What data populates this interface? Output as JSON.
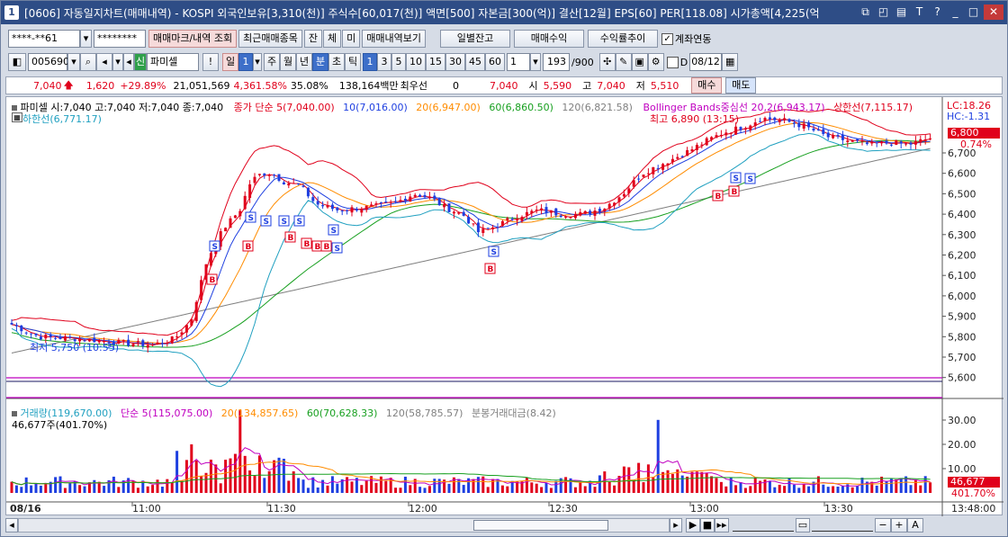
{
  "title": {
    "num": "1",
    "text": "[0606] 자동일지차트(매매내역) - KOSPI 외국인보유[3,310(천)] 주식수[60,017(천)] 액면[500] 자본금[300(억)] 결산[12월] EPS[60] PER[118.08] 시가총액[4,225(억"
  },
  "toolbar1": {
    "account": "****-**61",
    "password": "********",
    "trade_mark_btn": "매매마크/내역 조회",
    "recent_btn": "최근매매종목",
    "tab_jan": "잔",
    "tab_che": "체",
    "tab_mi": "미",
    "history_btn": "매매내역보기",
    "daily_balance_btn": "일별잔고",
    "trade_profit_btn": "매매수익",
    "profit_trend_btn": "수익률추이",
    "account_link_label": "계좌연동"
  },
  "toolbar2": {
    "code": "005690",
    "shin": "신",
    "name": "파미셀",
    "excl": "!",
    "period_day": "일",
    "period_num": "1",
    "week": "주",
    "month": "월",
    "year": "년",
    "minute": "분",
    "second": "초",
    "tick": "틱",
    "intervals": [
      "1",
      "3",
      "5",
      "10",
      "15",
      "30",
      "45",
      "60"
    ],
    "count": "1",
    "range": "193",
    "range_total": "/900",
    "d_label": "D",
    "date": "08/12"
  },
  "price": {
    "current": "7,040",
    "change": "1,620",
    "change_pct": "+29.89%",
    "volume": "21,051,569",
    "volume_ratio": "4,361.58%",
    "turnover": "35.08%",
    "amount": "138,164백만",
    "bid_label": "최우선",
    "bid_qty": "0",
    "ask_price": "7,040",
    "open_label": "시",
    "open": "5,590",
    "high_label": "고",
    "high": "7,040",
    "low_label": "저",
    "low": "5,510",
    "buy_btn": "매수",
    "sell_btn": "매도"
  },
  "legend": {
    "stock": "파미셀 시:7,040 고:7,040 저:7,040 종:7,040",
    "ma_title": "종가 단순 5(7,040.00)",
    "ma10": "10(7,016.00)",
    "ma20": "20(6,947.00)",
    "ma60": "60(6,860.50)",
    "ma120": "120(6,821.58)",
    "bb_title": "Bollinger Bands중심선 20,2(6,943.17)",
    "bb_upper": "상한선(7,115.17)",
    "bb_lower": "하한선(6,771.17)",
    "lc": "LC:18.26",
    "hc": "HC:-1.31",
    "max_label": "최고 6,890 (13:15)",
    "min_label": "최저 5,750 (10:55)",
    "vol_title": "거래량(119,670.00)",
    "vol_ma5": "단순 5(115,075.00)",
    "vol_ma20": "20(134,857.65)",
    "vol_ma60": "60(70,628.33)",
    "vol_ma120": "120(58,785.57)",
    "vol_amt": "분봉거래대금(8.42)",
    "vol_sub": "46,677주(401.70%)"
  },
  "price_axis": [
    "6,700",
    "6,600",
    "6,500",
    "6,400",
    "6,300",
    "6,200",
    "6,100",
    "6,000",
    "5,900",
    "5,800",
    "5,700",
    "5,600"
  ],
  "price_tag": "6,800",
  "price_tag_pct": "0.74%",
  "vol_axis": [
    "30.00",
    "20.00",
    "10.00"
  ],
  "vol_tag": "46,677",
  "vol_tag_pct": "401.70%",
  "time_axis": [
    "08/16",
    "11:00",
    "11:30",
    "12:00",
    "12:30",
    "13:00",
    "13:30",
    "13:48:00"
  ],
  "colors": {
    "up": "#e0001b",
    "down": "#1e3fe0",
    "ma5": "#e0001b",
    "ma10": "#1e3fe0",
    "ma20": "#ff8c00",
    "ma60": "#18a020",
    "ma120": "#808080",
    "bb": "#e0001b",
    "bb_lower": "#20a0c0",
    "magenta": "#c000c0"
  }
}
